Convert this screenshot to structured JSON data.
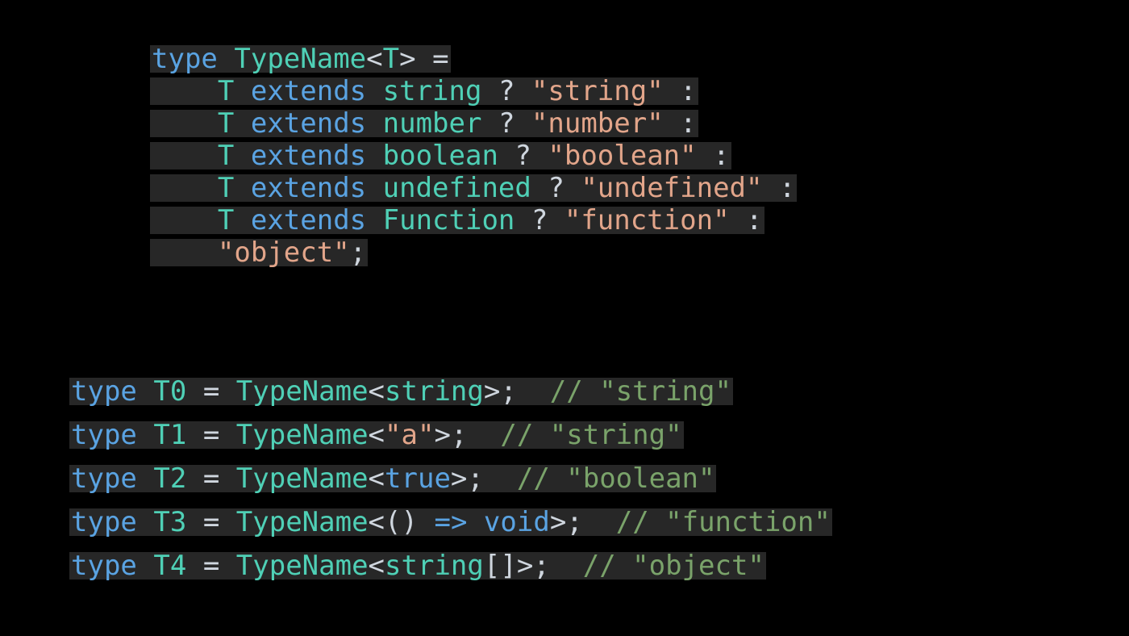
{
  "colors": {
    "background": "#000000",
    "lineBg": "#272727",
    "keyword": "#5aa3e2",
    "typeName": "#4fd0b6",
    "string": "#e2a58a",
    "operator": "#cfd6de",
    "comment": "#7aa36a"
  },
  "def": {
    "head": {
      "kw": "type",
      "sp1": " ",
      "name": "TypeName",
      "lt": "<",
      "T": "T",
      "gt": ">",
      "sp2": " ",
      "eq": "="
    },
    "branches": [
      {
        "indent": "    ",
        "T": "T",
        "sp1": " ",
        "kw": "extends",
        "sp2": " ",
        "ty": "string",
        "sp3": " ",
        "q": "?",
        "sp4": " ",
        "str": "\"string\"",
        "sp5": " ",
        "colon": ":"
      },
      {
        "indent": "    ",
        "T": "T",
        "sp1": " ",
        "kw": "extends",
        "sp2": " ",
        "ty": "number",
        "sp3": " ",
        "q": "?",
        "sp4": " ",
        "str": "\"number\"",
        "sp5": " ",
        "colon": ":"
      },
      {
        "indent": "    ",
        "T": "T",
        "sp1": " ",
        "kw": "extends",
        "sp2": " ",
        "ty": "boolean",
        "sp3": " ",
        "q": "?",
        "sp4": " ",
        "str": "\"boolean\"",
        "sp5": " ",
        "colon": ":"
      },
      {
        "indent": "    ",
        "T": "T",
        "sp1": " ",
        "kw": "extends",
        "sp2": " ",
        "ty": "undefined",
        "sp3": " ",
        "q": "?",
        "sp4": " ",
        "str": "\"undefined\"",
        "sp5": " ",
        "colon": ":"
      },
      {
        "indent": "    ",
        "T": "T",
        "sp1": " ",
        "kw": "extends",
        "sp2": " ",
        "ty": "Function",
        "sp3": " ",
        "q": "?",
        "sp4": " ",
        "str": "\"function\"",
        "sp5": " ",
        "colon": ":"
      }
    ],
    "tail": {
      "indent": "    ",
      "str": "\"object\"",
      "semi": ";"
    }
  },
  "examples": [
    {
      "kw": "type",
      "sp1": " ",
      "alias": "T0",
      "sp2": " ",
      "eq": "=",
      "sp3": " ",
      "name": "TypeName",
      "lt": "<",
      "arg": {
        "kind": "type",
        "text": "string"
      },
      "gt": ">",
      "semi": ";",
      "sp4": "  ",
      "cm": "// \"string\""
    },
    {
      "kw": "type",
      "sp1": " ",
      "alias": "T1",
      "sp2": " ",
      "eq": "=",
      "sp3": " ",
      "name": "TypeName",
      "lt": "<",
      "arg": {
        "kind": "str",
        "text": "\"a\""
      },
      "gt": ">",
      "semi": ";",
      "sp4": "  ",
      "cm": "// \"string\""
    },
    {
      "kw": "type",
      "sp1": " ",
      "alias": "T2",
      "sp2": " ",
      "eq": "=",
      "sp3": " ",
      "name": "TypeName",
      "lt": "<",
      "arg": {
        "kind": "kw",
        "text": "true"
      },
      "gt": ">",
      "semi": ";",
      "sp4": "  ",
      "cm": "// \"boolean\""
    },
    {
      "kw": "type",
      "sp1": " ",
      "alias": "T3",
      "sp2": " ",
      "eq": "=",
      "sp3": " ",
      "name": "TypeName",
      "lt": "<",
      "arg": {
        "kind": "fn",
        "lp": "(",
        "rp": ")",
        "sp": " ",
        "arrow": "=>",
        "sp2": " ",
        "ret": "void"
      },
      "gt": ">",
      "semi": ";",
      "sp4": "  ",
      "cm": "// \"function\""
    },
    {
      "kw": "type",
      "sp1": " ",
      "alias": "T4",
      "sp2": " ",
      "eq": "=",
      "sp3": " ",
      "name": "TypeName",
      "lt": "<",
      "arg": {
        "kind": "arr",
        "ty": "string",
        "br": "[]"
      },
      "gt": ">",
      "semi": ";",
      "sp4": "  ",
      "cm": "// \"object\""
    }
  ]
}
